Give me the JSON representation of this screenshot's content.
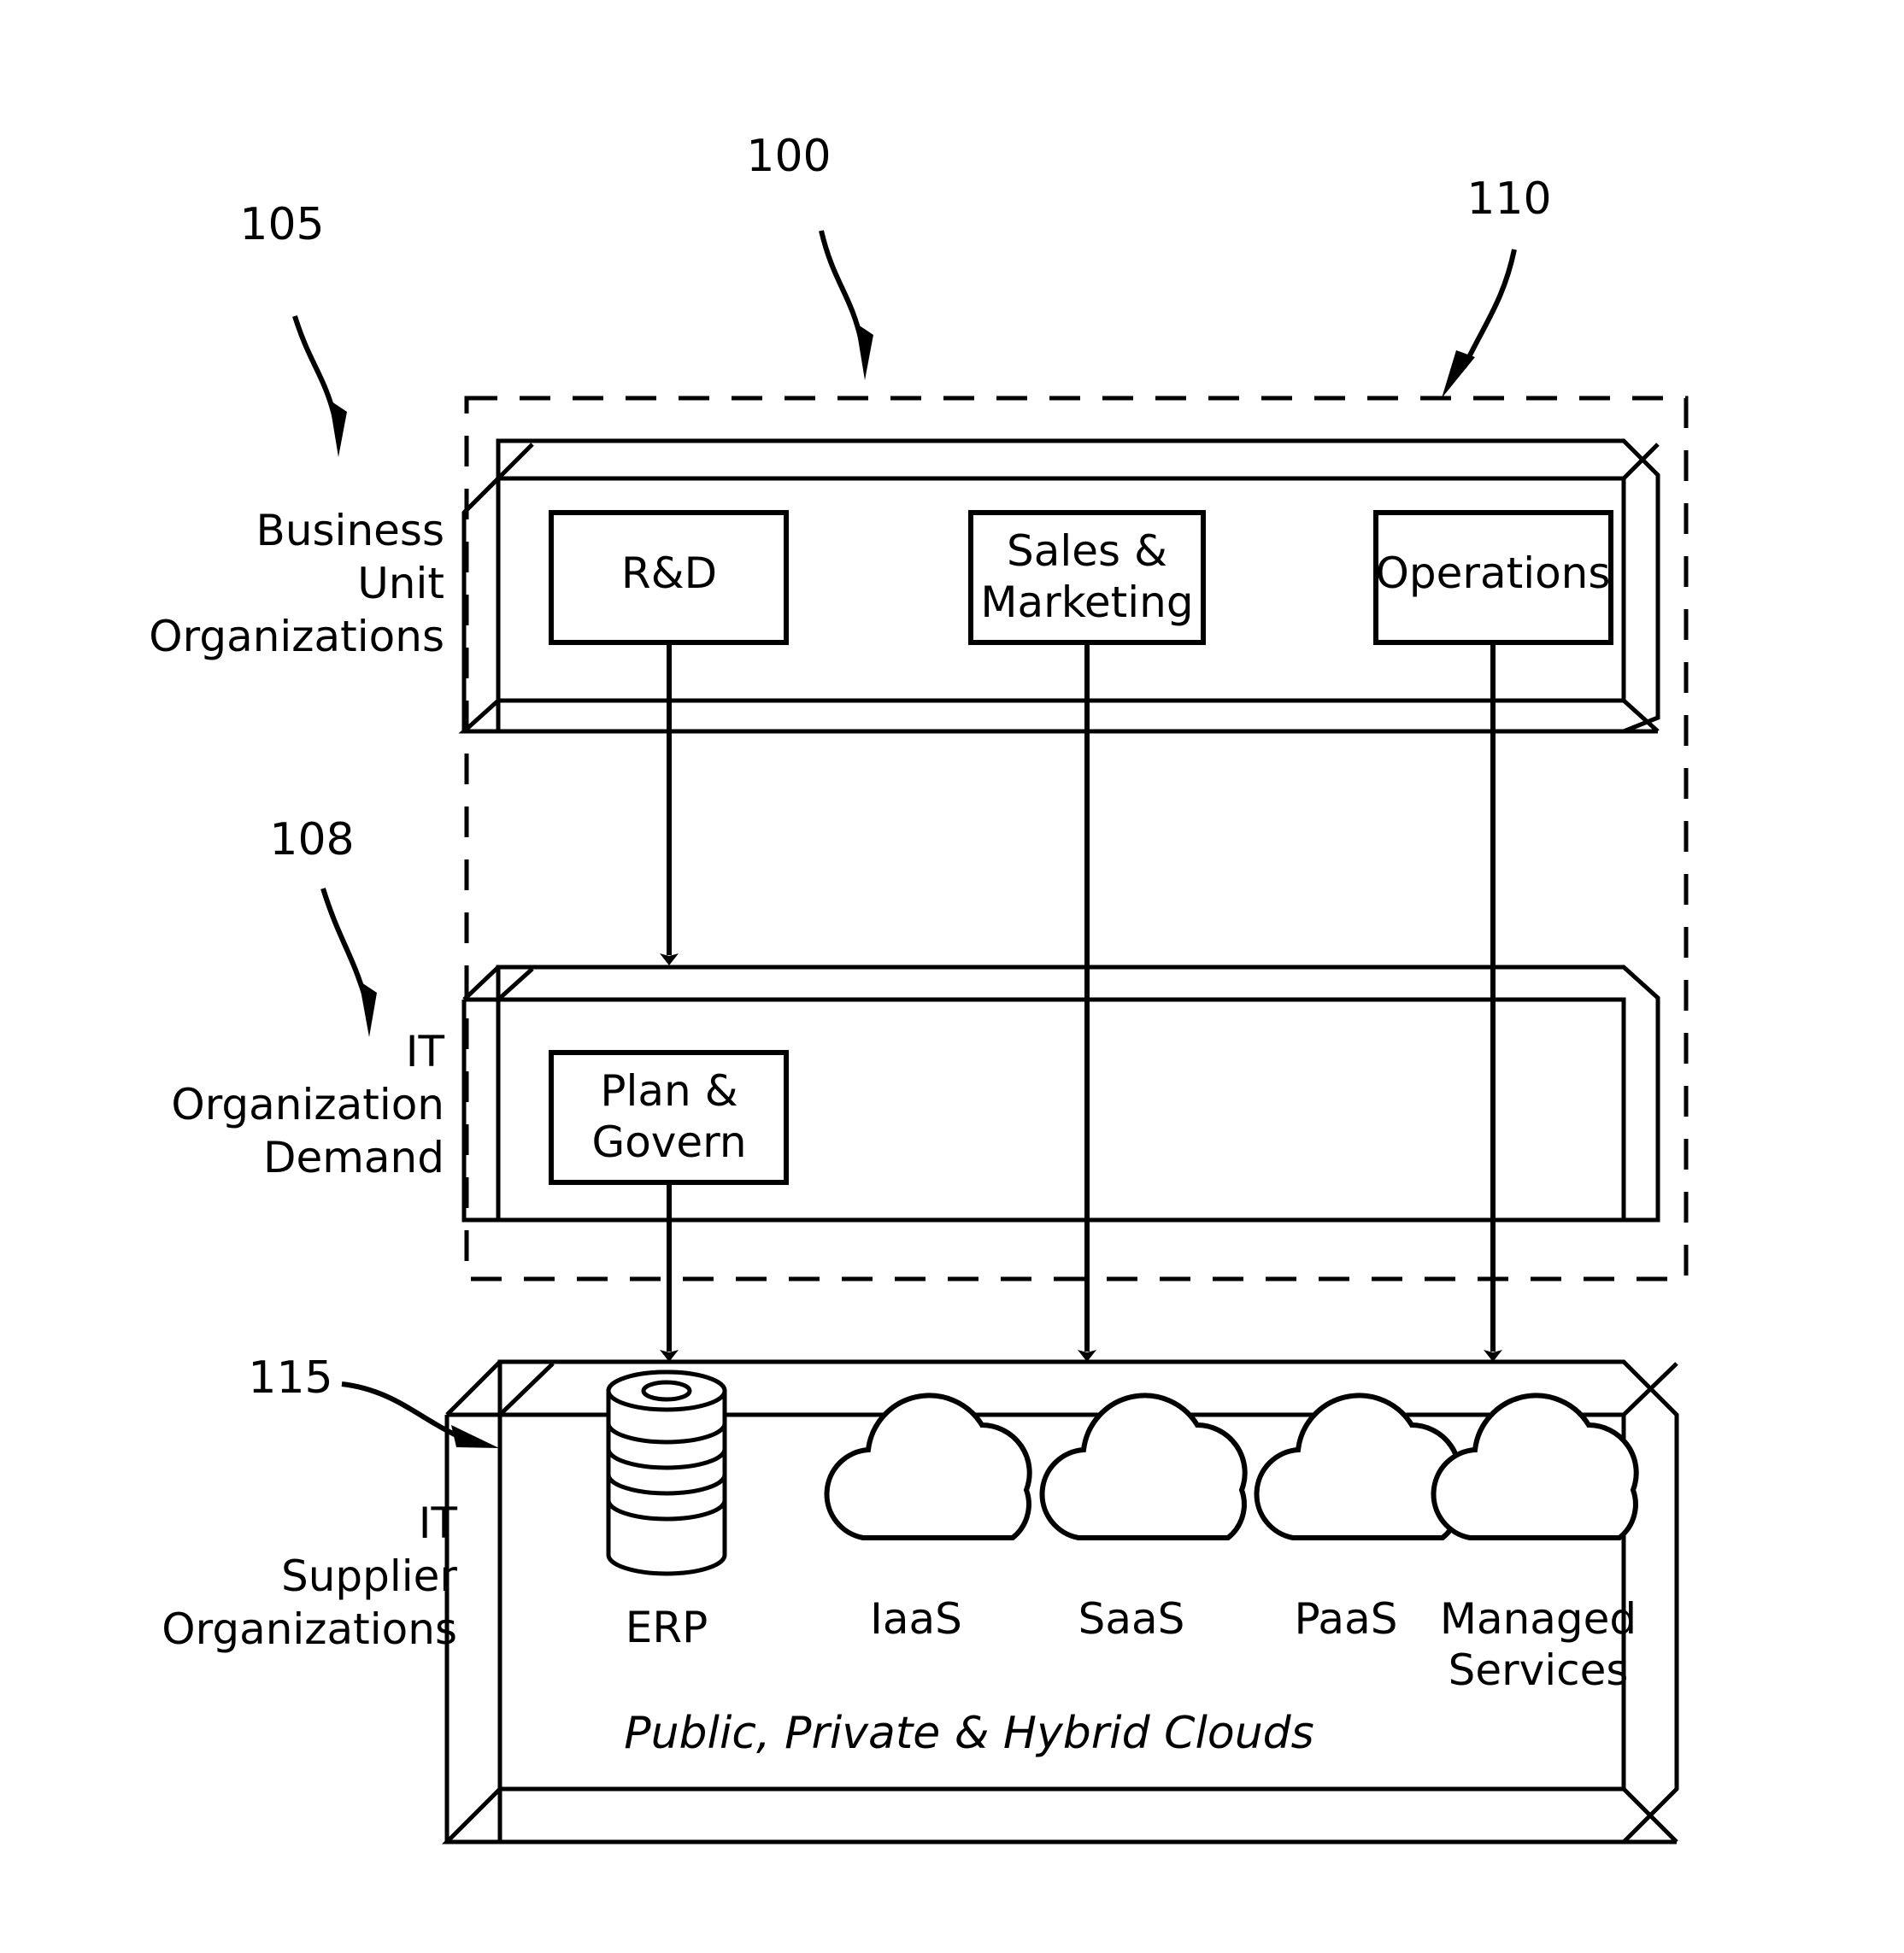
{
  "figure": {
    "type": "patent-diagram",
    "reference_numerals": [
      {
        "id": "ref-100",
        "text": "100"
      },
      {
        "id": "ref-105",
        "text": "105"
      },
      {
        "id": "ref-110",
        "text": "110"
      },
      {
        "id": "ref-108",
        "text": "108"
      },
      {
        "id": "ref-115",
        "text": "115"
      }
    ],
    "side_labels": {
      "business_unit": [
        "Business",
        "Unit",
        "Organizations"
      ],
      "it_demand": [
        "IT",
        "Organization",
        "Demand"
      ],
      "it_supplier": [
        "IT",
        "Supplier",
        "Organizations"
      ]
    },
    "tiers": [
      {
        "name": "business-unit-organizations",
        "ref": "105",
        "boxes": [
          {
            "id": "rd",
            "lines": [
              "R&D"
            ]
          },
          {
            "id": "sales-marketing",
            "lines": [
              "Sales  &",
              "Marketing"
            ]
          },
          {
            "id": "operations",
            "lines": [
              "Operations"
            ]
          }
        ]
      },
      {
        "name": "it-organization-demand",
        "ref": "108",
        "boxes": [
          {
            "id": "plan-govern",
            "lines": [
              "Plan  &",
              "Govern"
            ]
          }
        ]
      },
      {
        "name": "it-supplier-organizations",
        "ref": "115",
        "caption": "Public,  Private  &  Hybrid  Clouds",
        "services": [
          {
            "id": "erp",
            "icon": "database-cylinder-icon",
            "lines": [
              "ERP"
            ]
          },
          {
            "id": "iaas",
            "icon": "cloud-icon",
            "lines": [
              "IaaS"
            ]
          },
          {
            "id": "saas",
            "icon": "cloud-icon",
            "lines": [
              "SaaS"
            ]
          },
          {
            "id": "paas",
            "icon": "cloud-icon",
            "lines": [
              "PaaS"
            ]
          },
          {
            "id": "managed-services",
            "icon": "cloud-icon",
            "lines": [
              "Managed",
              "Services"
            ]
          }
        ]
      }
    ],
    "connectors": [
      {
        "from": "rd",
        "to": "it-organization-demand"
      },
      {
        "from": "plan-govern",
        "to": "it-supplier-organizations"
      },
      {
        "from": "sales-marketing",
        "to": "it-supplier-organizations"
      },
      {
        "from": "operations",
        "to": "it-supplier-organizations"
      }
    ],
    "dashed_boundary_ref": "110",
    "colors": {
      "stroke": "#000000",
      "fill": "#ffffff"
    }
  }
}
